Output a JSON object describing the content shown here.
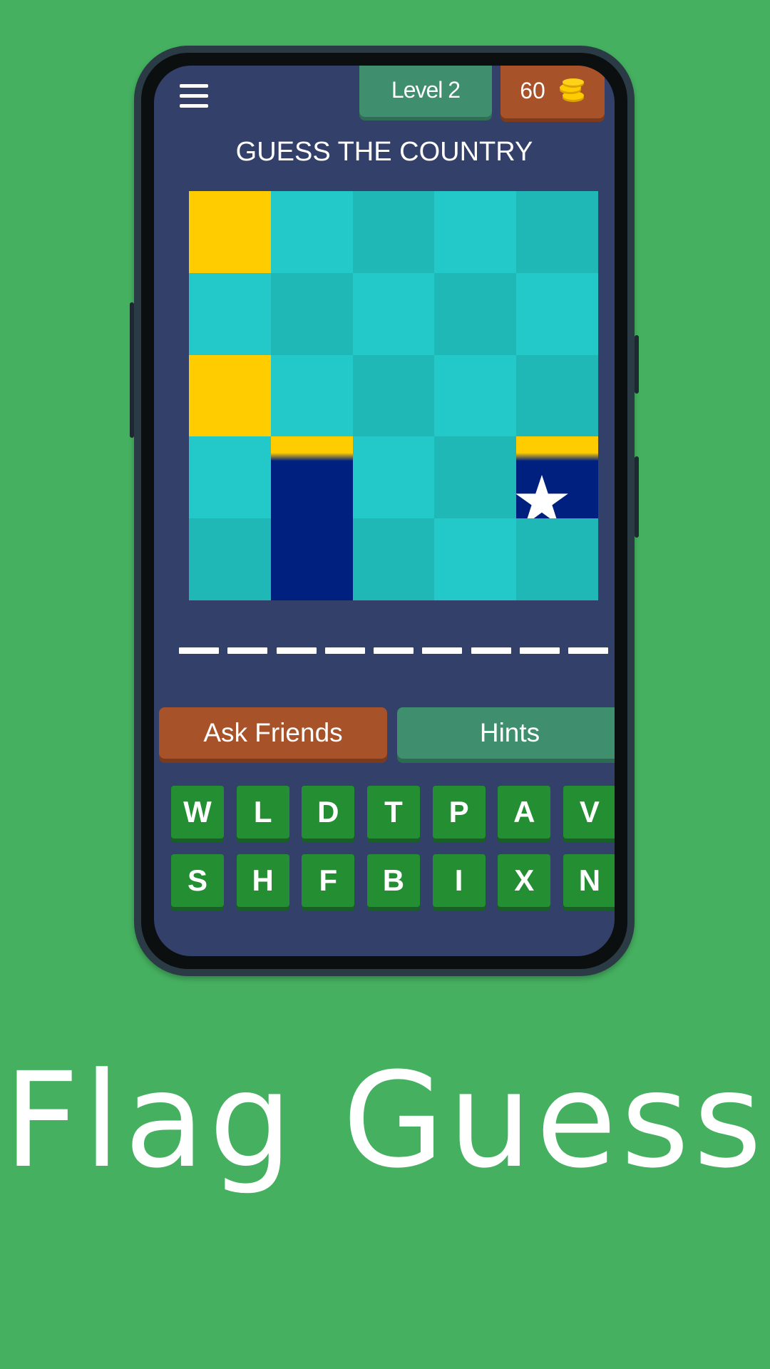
{
  "header": {
    "menu_icon": "hamburger-menu-icon",
    "level_label": "Level 2",
    "coins": "60",
    "coin_icon": "coin-stack-icon"
  },
  "game": {
    "title": "GUESS THE COUNTRY",
    "answer_slot_count": 9,
    "tiles": [
      {
        "color": "#ffcc00"
      },
      {
        "color": "#22c9c8"
      },
      {
        "color": "#1fb8b6"
      },
      {
        "color": "#22c9c8"
      },
      {
        "color": "#1fb8b6"
      },
      {
        "color": "#22c9c8"
      },
      {
        "color": "#1fb8b6"
      },
      {
        "color": "#22c9c8"
      },
      {
        "color": "#1fb8b6"
      },
      {
        "color": "#22c9c8"
      },
      {
        "color": "#ffcc00"
      },
      {
        "color": "#22c9c8"
      },
      {
        "color": "#1fb8b6"
      },
      {
        "color": "#22c9c8"
      },
      {
        "color": "#1fb8b6"
      },
      {
        "color": "#22c9c8"
      },
      {
        "color": "revealed-blue-yellow-stripe"
      },
      {
        "color": "#22c9c8"
      },
      {
        "color": "#1fb8b6"
      },
      {
        "color": "revealed-blue-yellow-star"
      },
      {
        "color": "#1fb8b6"
      },
      {
        "color": "#002080"
      },
      {
        "color": "#1fb8b6"
      },
      {
        "color": "#22c9c8"
      },
      {
        "color": "#1fb8b6"
      }
    ]
  },
  "actions": {
    "ask_friends": "Ask Friends",
    "hints": "Hints"
  },
  "keyboard": {
    "row1": [
      "W",
      "L",
      "D",
      "T",
      "P",
      "A",
      "V"
    ],
    "row2": [
      "S",
      "H",
      "F",
      "B",
      "I",
      "X",
      "N"
    ]
  },
  "colors": {
    "background": "#45b160",
    "screen": "#33416a",
    "level_tab": "#3f8f6e",
    "coin_tab": "#a8522a",
    "key": "#248f32",
    "flag_blue": "#002080",
    "flag_yellow": "#ffcc00"
  },
  "app_title": "Flag Guess"
}
